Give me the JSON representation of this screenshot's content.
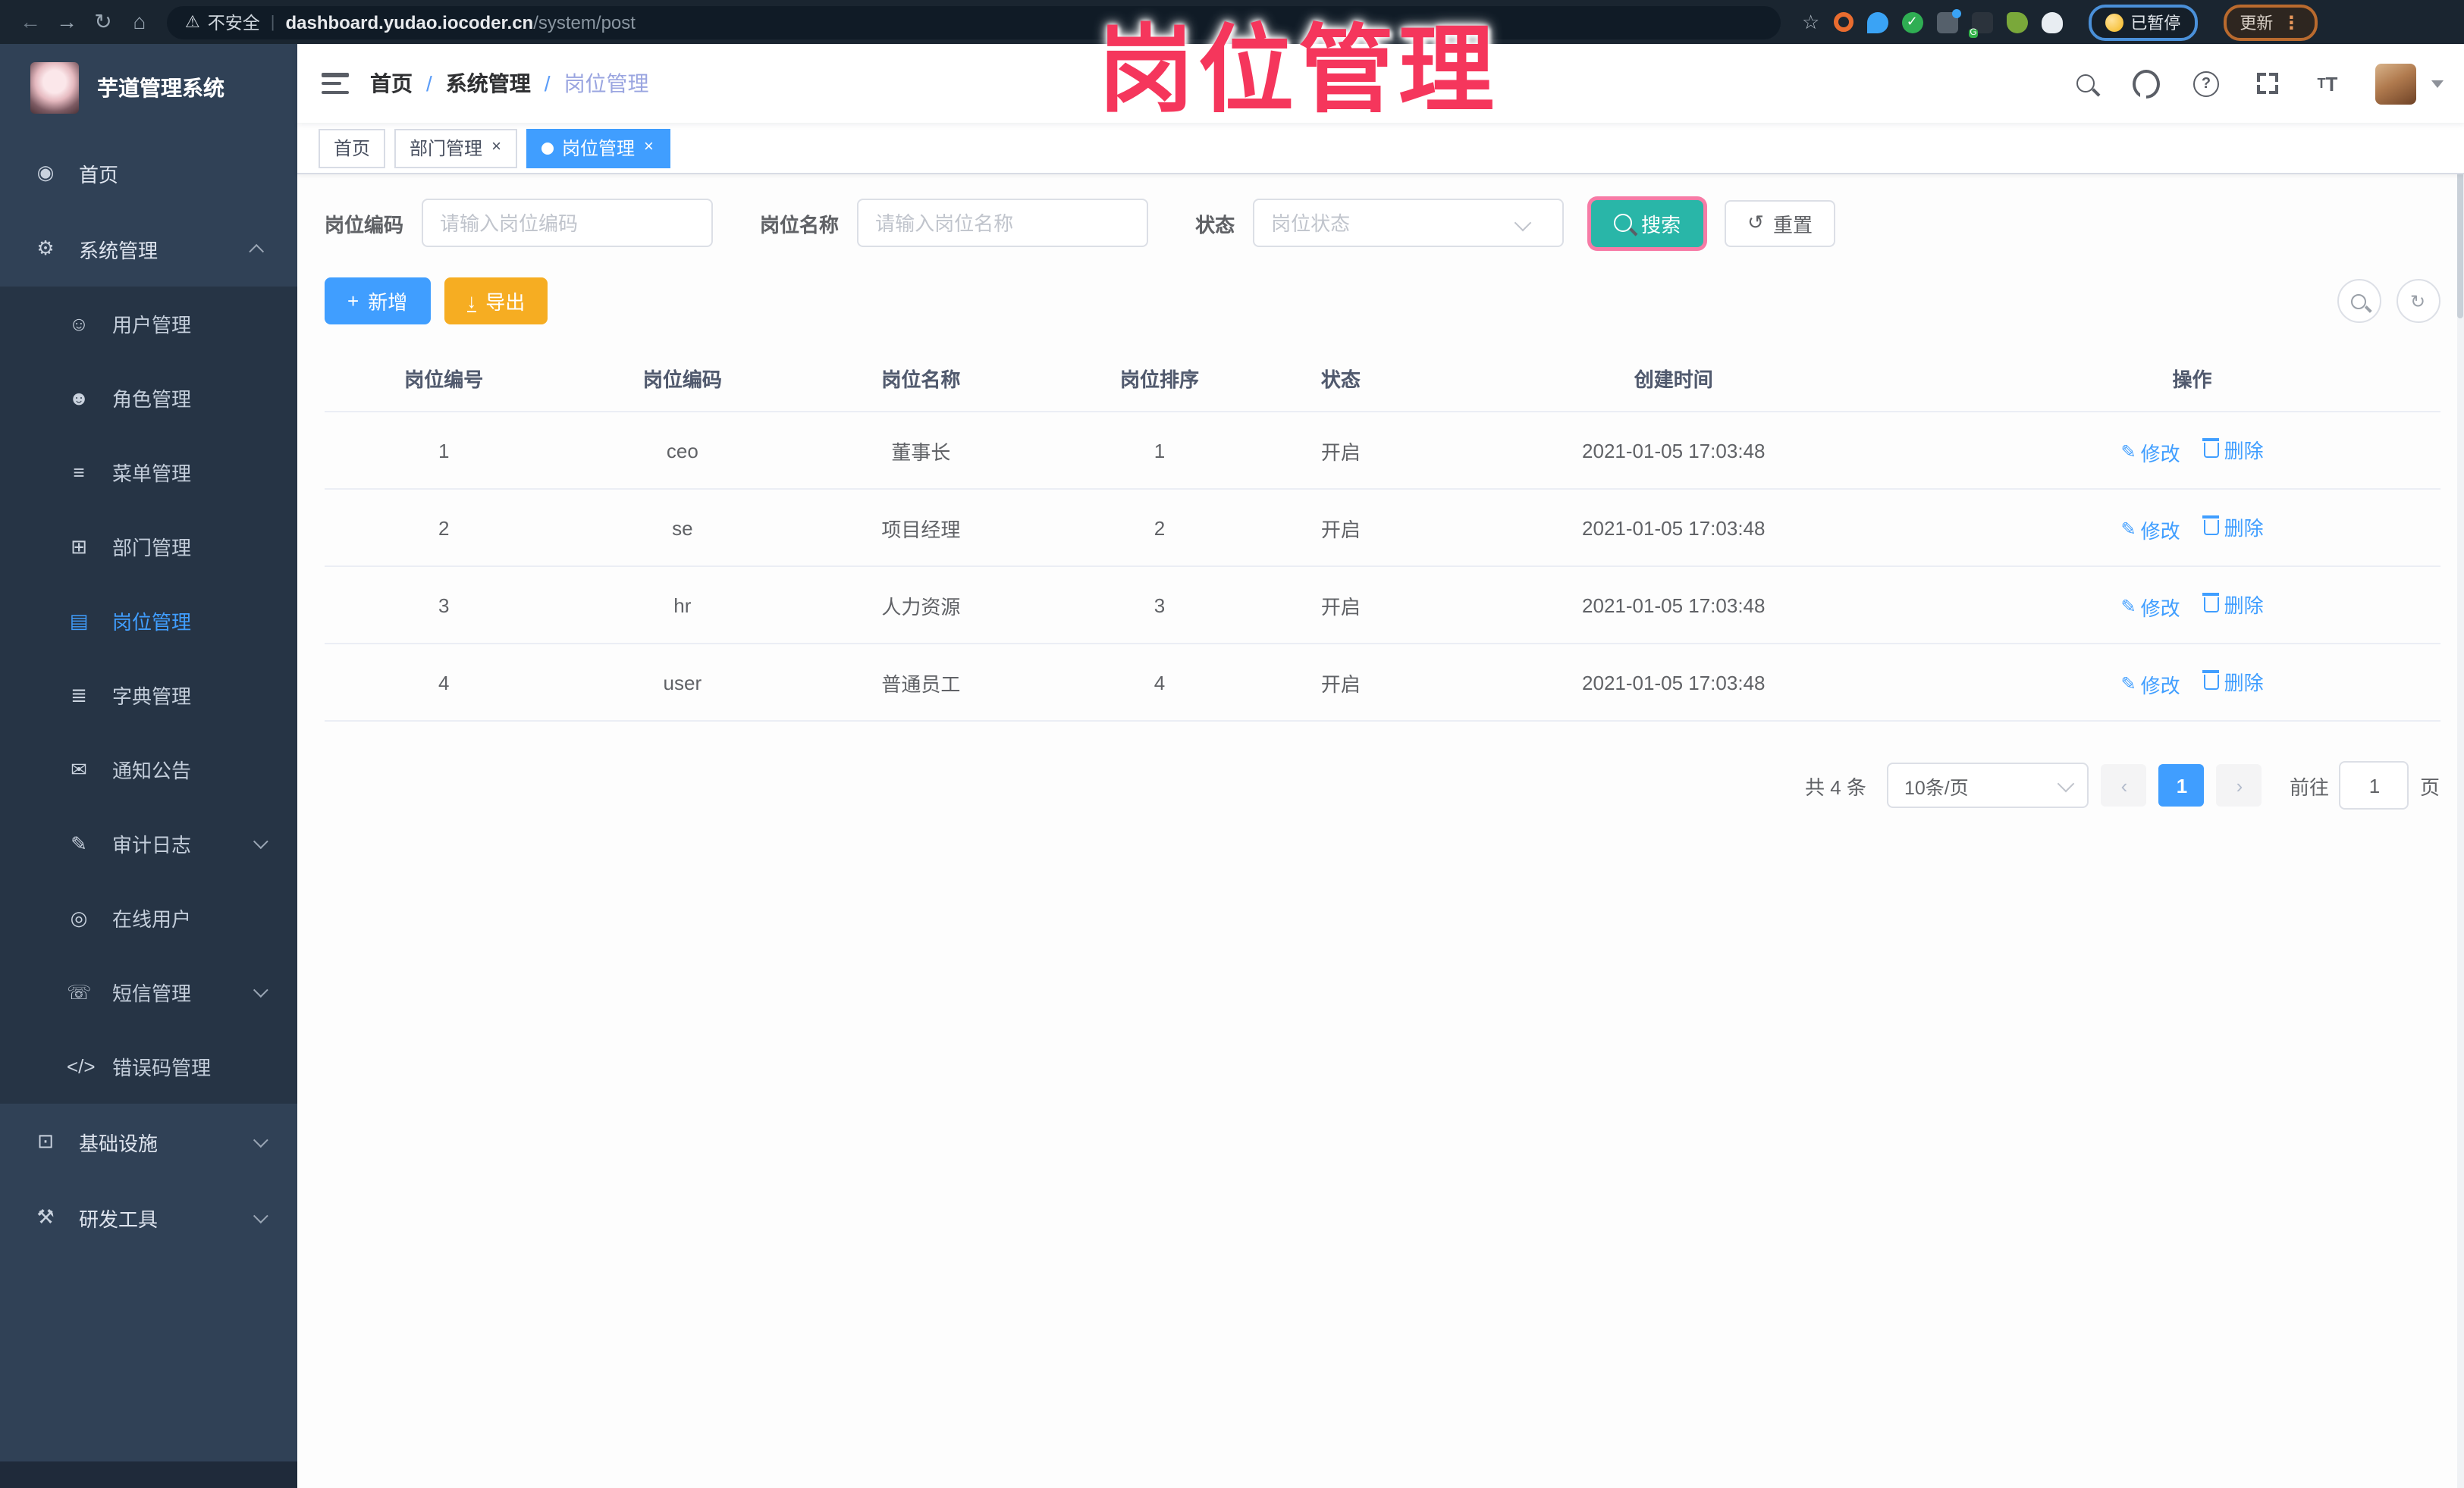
{
  "colors": {
    "accent": "#409eff",
    "search_teal": "#29b6a8",
    "export_amber": "#f6ad22",
    "annotation_pink": "#f5365c",
    "sidebar_bg": "#304156",
    "submenu_bg": "#263445"
  },
  "browser": {
    "security_label": "不安全",
    "url_domain": "dashboard.yudao.iocoder.cn",
    "url_path": "/system/post",
    "paused_label": "已暂停",
    "update_label": "更新"
  },
  "annotation": {
    "title": "岗位管理"
  },
  "sidebar": {
    "app_title": "芋道管理系统",
    "items": [
      {
        "label": "首页",
        "icon": "home-icon",
        "glyph": "◉",
        "level": "root"
      },
      {
        "label": "系统管理",
        "icon": "gear-icon",
        "glyph": "⚙",
        "level": "root",
        "open": true,
        "chevron": "up"
      },
      {
        "label": "用户管理",
        "icon": "user-icon",
        "glyph": "☺",
        "level": "sub"
      },
      {
        "label": "角色管理",
        "icon": "role-icon",
        "glyph": "☻",
        "level": "sub"
      },
      {
        "label": "菜单管理",
        "icon": "menu-tree-icon",
        "glyph": "≡",
        "level": "sub"
      },
      {
        "label": "部门管理",
        "icon": "dept-icon",
        "glyph": "⊞",
        "level": "sub"
      },
      {
        "label": "岗位管理",
        "icon": "post-icon",
        "glyph": "▤",
        "level": "sub",
        "active": true
      },
      {
        "label": "字典管理",
        "icon": "dict-icon",
        "glyph": "≣",
        "level": "sub"
      },
      {
        "label": "通知公告",
        "icon": "notice-icon",
        "glyph": "✉",
        "level": "sub"
      },
      {
        "label": "审计日志",
        "icon": "audit-log-icon",
        "glyph": "✎",
        "level": "sub",
        "chevron": "down"
      },
      {
        "label": "在线用户",
        "icon": "online-users-icon",
        "glyph": "◎",
        "level": "sub"
      },
      {
        "label": "短信管理",
        "icon": "sms-icon",
        "glyph": "☏",
        "level": "sub",
        "chevron": "down"
      },
      {
        "label": "错误码管理",
        "icon": "error-code-icon",
        "glyph": "</>",
        "level": "sub"
      },
      {
        "label": "基础设施",
        "icon": "infra-icon",
        "glyph": "⊡",
        "level": "root",
        "chevron": "down"
      },
      {
        "label": "研发工具",
        "icon": "devtools-icon",
        "glyph": "⚒",
        "level": "root",
        "chevron": "down"
      }
    ]
  },
  "navbar": {
    "breadcrumb": [
      "首页",
      "系统管理",
      "岗位管理"
    ]
  },
  "tabs": [
    {
      "label": "首页",
      "closable": false,
      "active": false
    },
    {
      "label": "部门管理",
      "closable": true,
      "active": false
    },
    {
      "label": "岗位管理",
      "closable": true,
      "active": true
    }
  ],
  "filters": {
    "code_label": "岗位编码",
    "code_placeholder": "请输入岗位编码",
    "name_label": "岗位名称",
    "name_placeholder": "请输入岗位名称",
    "status_label": "状态",
    "status_placeholder": "岗位状态",
    "search_label": "搜索",
    "reset_label": "重置"
  },
  "toolbar": {
    "add_label": "新增",
    "export_label": "导出"
  },
  "table": {
    "columns": [
      "岗位编号",
      "岗位编码",
      "岗位名称",
      "岗位排序",
      "状态",
      "创建时间",
      "操作"
    ],
    "rows": [
      {
        "id": "1",
        "code": "ceo",
        "name": "董事长",
        "sort": "1",
        "status": "开启",
        "created": "2021-01-05 17:03:48"
      },
      {
        "id": "2",
        "code": "se",
        "name": "项目经理",
        "sort": "2",
        "status": "开启",
        "created": "2021-01-05 17:03:48"
      },
      {
        "id": "3",
        "code": "hr",
        "name": "人力资源",
        "sort": "3",
        "status": "开启",
        "created": "2021-01-05 17:03:48"
      },
      {
        "id": "4",
        "code": "user",
        "name": "普通员工",
        "sort": "4",
        "status": "开启",
        "created": "2021-01-05 17:03:48"
      }
    ],
    "edit_label": "修改",
    "delete_label": "删除"
  },
  "pagination": {
    "total": "共 4 条",
    "page_size": "10条/页",
    "page": "1",
    "goto": "前往",
    "goto_value": "1",
    "unit": "页"
  }
}
